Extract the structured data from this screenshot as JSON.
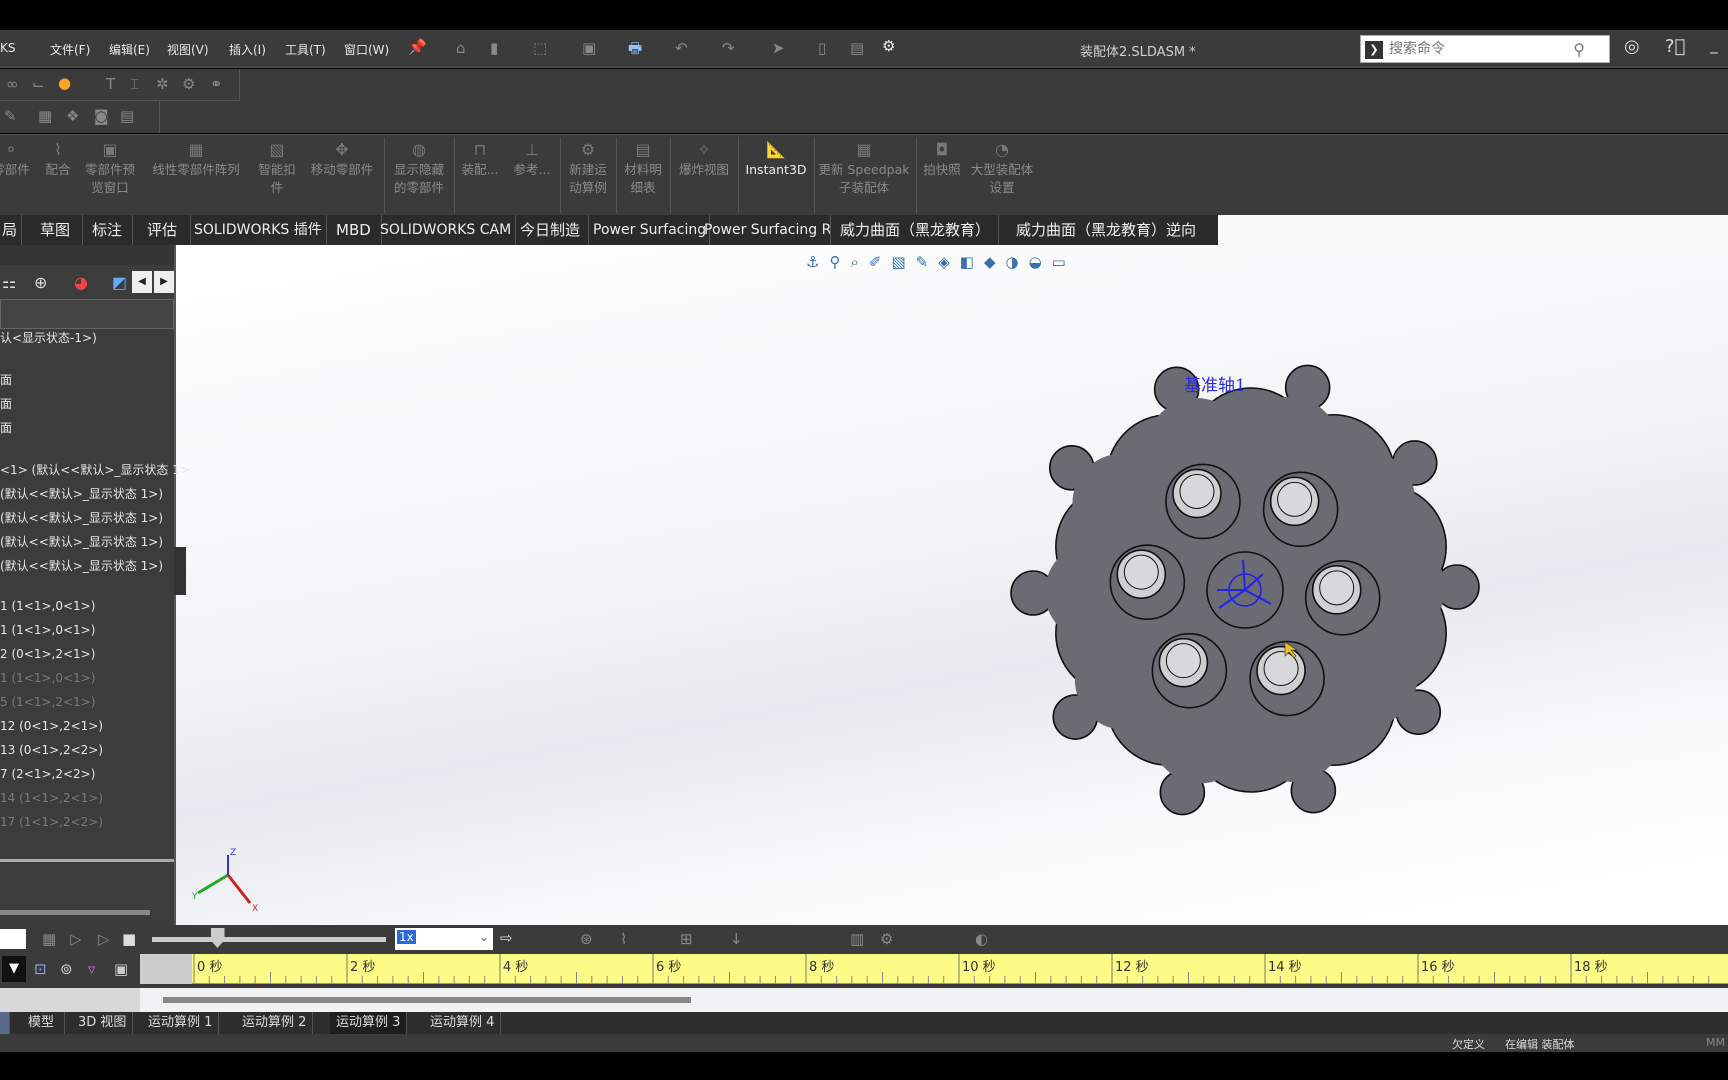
{
  "menubar": {
    "app_fragment": "KS",
    "menus": [
      "文件(F)",
      "编辑(E)",
      "视图(V)",
      "插入(I)",
      "工具(T)",
      "窗口(W)"
    ],
    "document_title": "装配体2.SLDASM *",
    "search_placeholder": "搜索命令"
  },
  "command_manager": {
    "buttons": [
      {
        "label": "零部件"
      },
      {
        "label": "配合"
      },
      {
        "label": "零部件预览窗口"
      },
      {
        "label": "线性零部件阵列"
      },
      {
        "label": "智能扣件"
      },
      {
        "label": "移动零部件"
      },
      {
        "label": "显示隐藏的零部件"
      },
      {
        "label": "装配..."
      },
      {
        "label": "参考..."
      },
      {
        "label": "新建运动算例"
      },
      {
        "label": "材料明细表"
      },
      {
        "label": "爆炸视图"
      },
      {
        "label": "Instant3D"
      },
      {
        "label": "更新 Speedpak 子装配体"
      },
      {
        "label": "拍快照"
      },
      {
        "label": "大型装配体设置"
      }
    ]
  },
  "tabs": [
    "局",
    "草图",
    "标注",
    "评估",
    "SOLIDWORKS 插件",
    "MBD",
    "SOLIDWORKS CAM",
    "今日制造",
    "Power Surfacing",
    "Power Surfacing RE",
    "威力曲面（黑龙教育）",
    "威力曲面（黑龙教育）逆向"
  ],
  "feature_tree": {
    "items": [
      {
        "text": "认<显示状态-1>)",
        "dim": false
      },
      {
        "text": "面",
        "dim": false
      },
      {
        "text": "面",
        "dim": false
      },
      {
        "text": "面",
        "dim": false
      },
      {
        "text": "<1> (默认<<默认>_显示状态 1>",
        "dim": false
      },
      {
        "text": " (默认<<默认>_显示状态 1>)",
        "dim": false
      },
      {
        "text": " (默认<<默认>_显示状态 1>)",
        "dim": false
      },
      {
        "text": " (默认<<默认>_显示状态 1>)",
        "dim": false
      },
      {
        "text": " (默认<<默认>_显示状态 1>)",
        "dim": false
      },
      {
        "text": "1 (1<1>,0<1>)",
        "dim": false
      },
      {
        "text": "1 (1<1>,0<1>)",
        "dim": false
      },
      {
        "text": "2 (0<1>,2<1>)",
        "dim": false
      },
      {
        "text": "1 (1<1>,0<1>)",
        "dim": true
      },
      {
        "text": "5 (1<1>,2<1>)",
        "dim": true
      },
      {
        "text": "12 (0<1>,2<1>)",
        "dim": false
      },
      {
        "text": "13 (0<1>,2<2>)",
        "dim": false
      },
      {
        "text": "7 (2<1>,2<2>)",
        "dim": false
      },
      {
        "text": "14 (1<1>,2<1>)",
        "dim": true
      },
      {
        "text": "17 (1<1>,2<2>)",
        "dim": true
      }
    ]
  },
  "viewport": {
    "annotation": "基准轴1",
    "model_color": "#6b6b73",
    "triad_axes": [
      "Y",
      "Z",
      "X"
    ]
  },
  "motion": {
    "speed_value": "1x",
    "timeline_labels": [
      "0 秒",
      "2 秒",
      "4 秒",
      "6 秒",
      "8 秒",
      "10 秒",
      "12 秒",
      "14 秒",
      "16 秒",
      "18 秒"
    ],
    "playhead_fraction": 0.28
  },
  "bottom_tabs": [
    "模型",
    "3D 视图",
    "运动算例 1",
    "运动算例 2",
    "运动算例 3",
    "运动算例 4"
  ],
  "status": {
    "state": "欠定义",
    "mode": "在编辑 装配体",
    "units": "MM"
  }
}
